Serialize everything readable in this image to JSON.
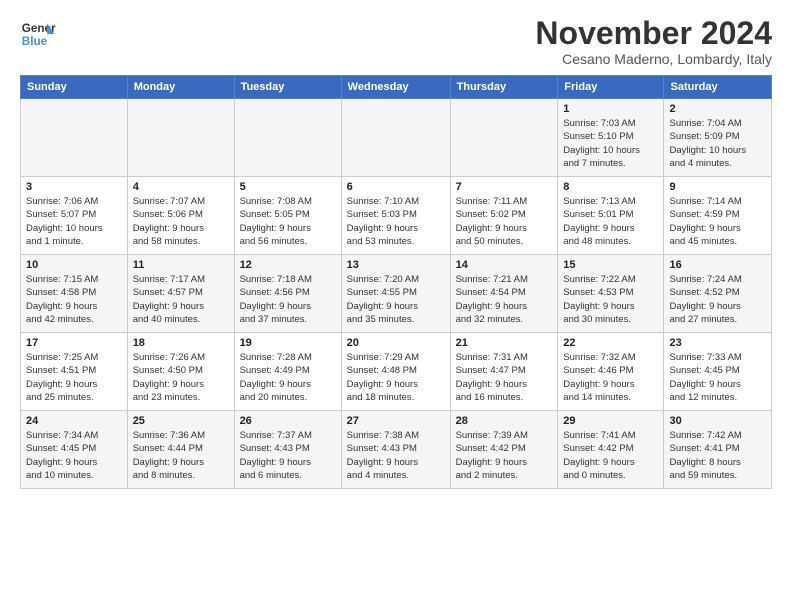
{
  "logo": {
    "line1": "General",
    "line2": "Blue"
  },
  "title": "November 2024",
  "subtitle": "Cesano Maderno, Lombardy, Italy",
  "header": {
    "days": [
      "Sunday",
      "Monday",
      "Tuesday",
      "Wednesday",
      "Thursday",
      "Friday",
      "Saturday"
    ]
  },
  "weeks": [
    [
      {
        "num": "",
        "detail": ""
      },
      {
        "num": "",
        "detail": ""
      },
      {
        "num": "",
        "detail": ""
      },
      {
        "num": "",
        "detail": ""
      },
      {
        "num": "",
        "detail": ""
      },
      {
        "num": "1",
        "detail": "Sunrise: 7:03 AM\nSunset: 5:10 PM\nDaylight: 10 hours\nand 7 minutes."
      },
      {
        "num": "2",
        "detail": "Sunrise: 7:04 AM\nSunset: 5:09 PM\nDaylight: 10 hours\nand 4 minutes."
      }
    ],
    [
      {
        "num": "3",
        "detail": "Sunrise: 7:06 AM\nSunset: 5:07 PM\nDaylight: 10 hours\nand 1 minute."
      },
      {
        "num": "4",
        "detail": "Sunrise: 7:07 AM\nSunset: 5:06 PM\nDaylight: 9 hours\nand 58 minutes."
      },
      {
        "num": "5",
        "detail": "Sunrise: 7:08 AM\nSunset: 5:05 PM\nDaylight: 9 hours\nand 56 minutes."
      },
      {
        "num": "6",
        "detail": "Sunrise: 7:10 AM\nSunset: 5:03 PM\nDaylight: 9 hours\nand 53 minutes."
      },
      {
        "num": "7",
        "detail": "Sunrise: 7:11 AM\nSunset: 5:02 PM\nDaylight: 9 hours\nand 50 minutes."
      },
      {
        "num": "8",
        "detail": "Sunrise: 7:13 AM\nSunset: 5:01 PM\nDaylight: 9 hours\nand 48 minutes."
      },
      {
        "num": "9",
        "detail": "Sunrise: 7:14 AM\nSunset: 4:59 PM\nDaylight: 9 hours\nand 45 minutes."
      }
    ],
    [
      {
        "num": "10",
        "detail": "Sunrise: 7:15 AM\nSunset: 4:58 PM\nDaylight: 9 hours\nand 42 minutes."
      },
      {
        "num": "11",
        "detail": "Sunrise: 7:17 AM\nSunset: 4:57 PM\nDaylight: 9 hours\nand 40 minutes."
      },
      {
        "num": "12",
        "detail": "Sunrise: 7:18 AM\nSunset: 4:56 PM\nDaylight: 9 hours\nand 37 minutes."
      },
      {
        "num": "13",
        "detail": "Sunrise: 7:20 AM\nSunset: 4:55 PM\nDaylight: 9 hours\nand 35 minutes."
      },
      {
        "num": "14",
        "detail": "Sunrise: 7:21 AM\nSunset: 4:54 PM\nDaylight: 9 hours\nand 32 minutes."
      },
      {
        "num": "15",
        "detail": "Sunrise: 7:22 AM\nSunset: 4:53 PM\nDaylight: 9 hours\nand 30 minutes."
      },
      {
        "num": "16",
        "detail": "Sunrise: 7:24 AM\nSunset: 4:52 PM\nDaylight: 9 hours\nand 27 minutes."
      }
    ],
    [
      {
        "num": "17",
        "detail": "Sunrise: 7:25 AM\nSunset: 4:51 PM\nDaylight: 9 hours\nand 25 minutes."
      },
      {
        "num": "18",
        "detail": "Sunrise: 7:26 AM\nSunset: 4:50 PM\nDaylight: 9 hours\nand 23 minutes."
      },
      {
        "num": "19",
        "detail": "Sunrise: 7:28 AM\nSunset: 4:49 PM\nDaylight: 9 hours\nand 20 minutes."
      },
      {
        "num": "20",
        "detail": "Sunrise: 7:29 AM\nSunset: 4:48 PM\nDaylight: 9 hours\nand 18 minutes."
      },
      {
        "num": "21",
        "detail": "Sunrise: 7:31 AM\nSunset: 4:47 PM\nDaylight: 9 hours\nand 16 minutes."
      },
      {
        "num": "22",
        "detail": "Sunrise: 7:32 AM\nSunset: 4:46 PM\nDaylight: 9 hours\nand 14 minutes."
      },
      {
        "num": "23",
        "detail": "Sunrise: 7:33 AM\nSunset: 4:45 PM\nDaylight: 9 hours\nand 12 minutes."
      }
    ],
    [
      {
        "num": "24",
        "detail": "Sunrise: 7:34 AM\nSunset: 4:45 PM\nDaylight: 9 hours\nand 10 minutes."
      },
      {
        "num": "25",
        "detail": "Sunrise: 7:36 AM\nSunset: 4:44 PM\nDaylight: 9 hours\nand 8 minutes."
      },
      {
        "num": "26",
        "detail": "Sunrise: 7:37 AM\nSunset: 4:43 PM\nDaylight: 9 hours\nand 6 minutes."
      },
      {
        "num": "27",
        "detail": "Sunrise: 7:38 AM\nSunset: 4:43 PM\nDaylight: 9 hours\nand 4 minutes."
      },
      {
        "num": "28",
        "detail": "Sunrise: 7:39 AM\nSunset: 4:42 PM\nDaylight: 9 hours\nand 2 minutes."
      },
      {
        "num": "29",
        "detail": "Sunrise: 7:41 AM\nSunset: 4:42 PM\nDaylight: 9 hours\nand 0 minutes."
      },
      {
        "num": "30",
        "detail": "Sunrise: 7:42 AM\nSunset: 4:41 PM\nDaylight: 8 hours\nand 59 minutes."
      }
    ]
  ]
}
